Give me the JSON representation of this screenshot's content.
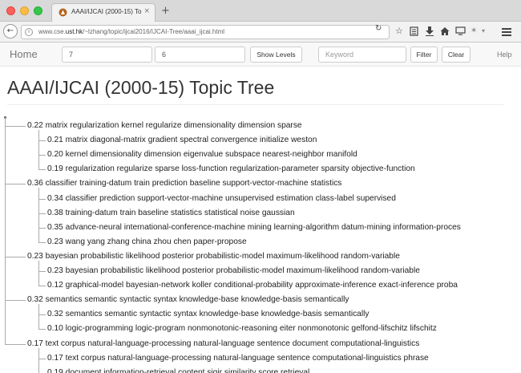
{
  "browser": {
    "tab_title": "AAAI/IJCAI (2000-15) Topi...",
    "tab_close": "×",
    "new_tab": "+",
    "url_prefix": "www.cse.",
    "url_host": "ust.hk",
    "url_path": "/~lzhang/topic/ijcai2016/IJCAI-Tree/aaai_ijcai.html"
  },
  "nav": {
    "brand": "Home",
    "field1_value": "7",
    "field2_value": "6",
    "show_levels_label": "Show Levels",
    "keyword_placeholder": "Keyword",
    "filter_label": "Filter",
    "clear_label": "Clear",
    "help_label": "Help"
  },
  "page": {
    "title": "AAAI/IJCAI (2000-15) Topic Tree"
  },
  "tree": [
    {
      "level": 1,
      "text": "0.22 matrix regularization kernel regularize dimensionality dimension sparse"
    },
    {
      "level": 2,
      "text": "0.21 matrix diagonal-matrix gradient spectral convergence initialize weston"
    },
    {
      "level": 2,
      "text": "0.20 kernel dimensionality dimension eigenvalue subspace nearest-neighbor manifold"
    },
    {
      "level": 2,
      "text": "0.19 regularization regularize sparse loss-function regularization-parameter sparsity objective-function"
    },
    {
      "level": 1,
      "text": "0.36 classifier training-datum train prediction baseline support-vector-machine statistics"
    },
    {
      "level": 2,
      "text": "0.34 classifier prediction support-vector-machine unsupervised estimation class-label supervised"
    },
    {
      "level": 2,
      "text": "0.38 training-datum train baseline statistics statistical noise gaussian"
    },
    {
      "level": 2,
      "text": "0.35 advance-neural international-conference-machine mining learning-algorithm datum-mining information-proces"
    },
    {
      "level": 2,
      "text": "0.23 wang yang zhang china zhou chen paper-propose"
    },
    {
      "level": 1,
      "text": "0.23 bayesian probabilistic likelihood posterior probabilistic-model maximum-likelihood random-variable"
    },
    {
      "level": 2,
      "text": "0.23 bayesian probabilistic likelihood posterior probabilistic-model maximum-likelihood random-variable"
    },
    {
      "level": 2,
      "text": "0.12 graphical-model bayesian-network koller conditional-probability approximate-inference exact-inference proba"
    },
    {
      "level": 1,
      "text": "0.32 semantics semantic syntactic syntax knowledge-base knowledge-basis semantically"
    },
    {
      "level": 2,
      "text": "0.32 semantics semantic syntactic syntax knowledge-base knowledge-basis semantically"
    },
    {
      "level": 2,
      "text": "0.10 logic-programming logic-program nonmonotonic-reasoning eiter nonmonotonic gelfond-lifschitz lifschitz"
    },
    {
      "level": 1,
      "text": "0.17 text corpus natural-language-processing natural-language sentence document computational-linguistics"
    },
    {
      "level": 2,
      "text": "0.17 text corpus natural-language-processing natural-language sentence computational-linguistics phrase"
    },
    {
      "level": 2,
      "text": "0.19 document information-retrieval content sigir similarity score retrieval"
    }
  ],
  "icons": {
    "back": "back-arrow-icon",
    "info": "info-icon",
    "reload": "reload-icon",
    "bookmark": "star-icon",
    "reading": "reading-list-icon",
    "download": "download-icon",
    "home": "home-icon",
    "cast": "screen-icon",
    "extension": "puzzle-icon",
    "menu": "hamburger-menu-icon"
  }
}
